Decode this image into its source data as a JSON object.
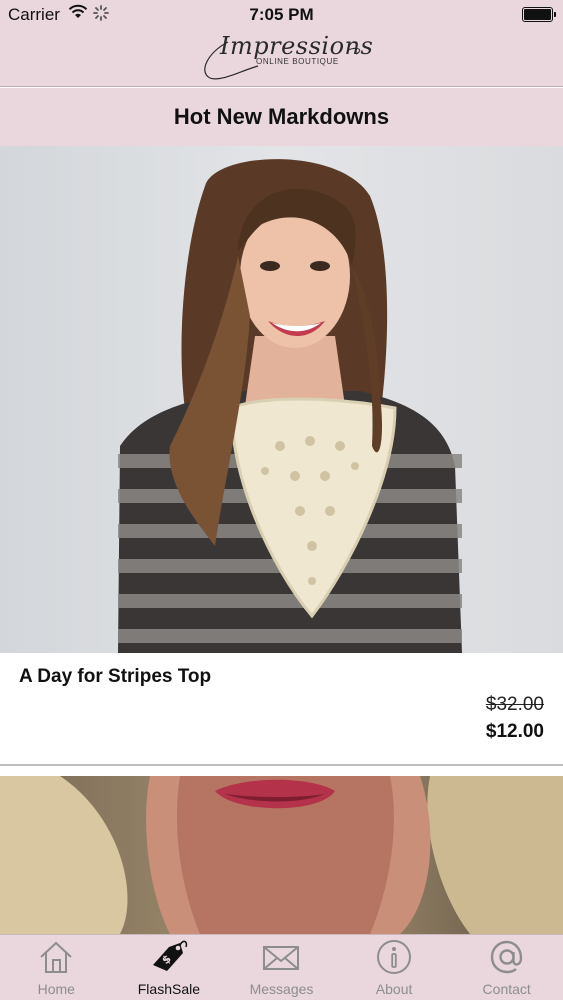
{
  "status_bar": {
    "carrier": "Carrier",
    "time": "7:05 PM"
  },
  "header": {
    "logo_script": "Impressions",
    "logo_sub": "ONLINE BOUTIQUE"
  },
  "page": {
    "title": "Hot New Markdowns"
  },
  "products": [
    {
      "name": "A Day for Stripes Top",
      "original_price": "$32.00",
      "sale_price": "$12.00"
    }
  ],
  "tabs": [
    {
      "label": "Home",
      "icon": "home-icon",
      "active": false
    },
    {
      "label": "FlashSale",
      "icon": "price-tag-icon",
      "active": true
    },
    {
      "label": "Messages",
      "icon": "envelope-icon",
      "active": false
    },
    {
      "label": "About",
      "icon": "info-icon",
      "active": false
    },
    {
      "label": "Contact",
      "icon": "at-sign-icon",
      "active": false
    }
  ],
  "colors": {
    "chrome_pink": "#ead7dd",
    "tab_inactive": "#8d8d8d",
    "tab_active": "#111111"
  }
}
